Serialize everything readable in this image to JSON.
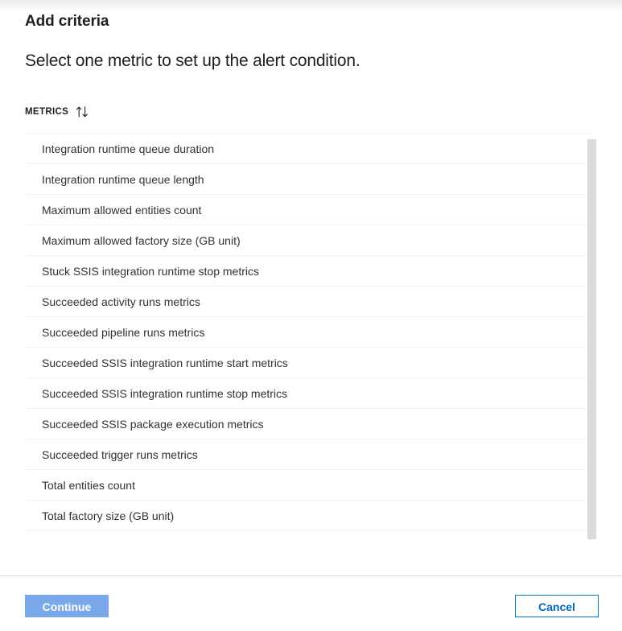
{
  "header": {
    "title": "Add criteria",
    "subtitle": "Select one metric to set up the alert condition."
  },
  "list": {
    "column_header": "METRICS",
    "sort_icon": "sort-arrows-icon",
    "rows": [
      "Integration runtime queue duration",
      "Integration runtime queue length",
      "Maximum allowed entities count",
      "Maximum allowed factory size (GB unit)",
      "Stuck SSIS integration runtime stop metrics",
      "Succeeded activity runs metrics",
      "Succeeded pipeline runs metrics",
      "Succeeded SSIS integration runtime start metrics",
      "Succeeded SSIS integration runtime stop metrics",
      "Succeeded SSIS package execution metrics",
      "Succeeded trigger runs metrics",
      "Total entities count",
      "Total factory size (GB unit)"
    ],
    "partial_row": ""
  },
  "footer": {
    "continue_label": "Continue",
    "cancel_label": "Cancel"
  },
  "colors": {
    "primary_button_bg": "#79a9eb",
    "secondary_button_border": "#0078d4",
    "secondary_button_text": "#0067c0",
    "row_divider": "#f3f2f1",
    "footer_divider": "#e1dfdd",
    "scrollbar_thumb": "#dadada",
    "text": "#323130"
  }
}
